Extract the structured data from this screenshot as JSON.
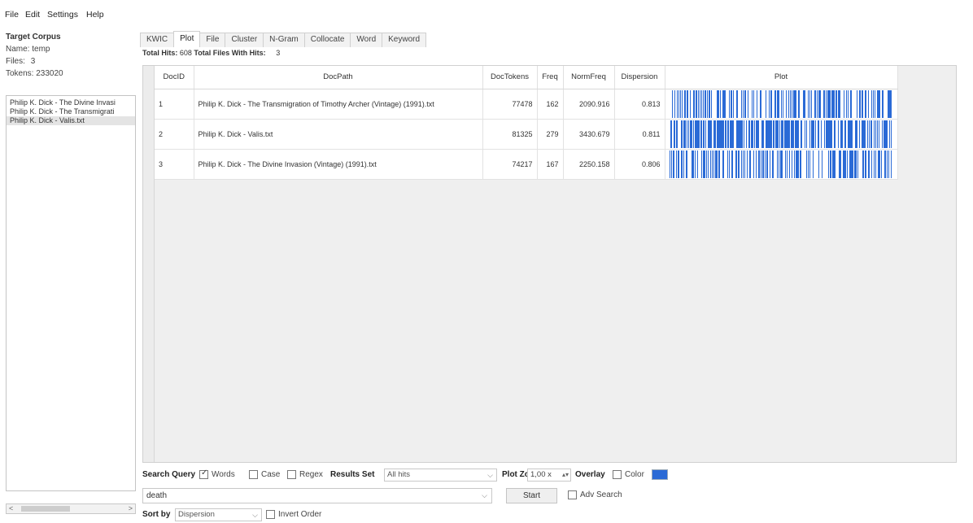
{
  "menu": [
    "File",
    "Edit",
    "Settings",
    "Help"
  ],
  "corpus": {
    "title": "Target Corpus",
    "name_label": "Name:",
    "name_value": "temp",
    "files_label": "Files:",
    "files_value": "3",
    "tokens_label": "Tokens:",
    "tokens_value": "233020",
    "files": [
      "Philip K. Dick - The Divine Invasi",
      "Philip K. Dick - The Transmigrati",
      "Philip K. Dick - Valis.txt"
    ],
    "selected_index": 2
  },
  "tabs": [
    "KWIC",
    "Plot",
    "File",
    "Cluster",
    "N-Gram",
    "Collocate",
    "Word",
    "Keyword"
  ],
  "active_tab": "Plot",
  "hits": {
    "total_hits_label": "Total Hits:",
    "total_hits_value": "608",
    "total_files_label": "Total Files With Hits:",
    "total_files_value": "3"
  },
  "table": {
    "columns": [
      "DocID",
      "DocPath",
      "DocTokens",
      "Freq",
      "NormFreq",
      "Dispersion",
      "Plot"
    ],
    "rows": [
      {
        "docid": "1",
        "docpath": "Philip K. Dick - The Transmigration of Timothy Archer (Vintage) (1991).txt",
        "doctokens": "77478",
        "freq": "162",
        "normfreq": "2090.916",
        "dispersion": "0.813"
      },
      {
        "docid": "2",
        "docpath": "Philip K. Dick - Valis.txt",
        "doctokens": "81325",
        "freq": "279",
        "normfreq": "3430.679",
        "dispersion": "0.811"
      },
      {
        "docid": "3",
        "docpath": "Philip K. Dick - The Divine Invasion (Vintage) (1991).txt",
        "doctokens": "74217",
        "freq": "167",
        "normfreq": "2250.158",
        "dispersion": "0.806"
      }
    ]
  },
  "controls": {
    "search_query_label": "Search Query",
    "words_label": "Words",
    "words_checked": true,
    "case_label": "Case",
    "case_checked": false,
    "regex_label": "Regex",
    "regex_checked": false,
    "results_set_label": "Results Set",
    "results_set_value": "All hits",
    "plot_zoom_label": "Plot Zoom",
    "plot_zoom_value": "1,00 x",
    "overlay_label": "Overlay",
    "overlay_checked": false,
    "color_label": "Color",
    "color_value": "#2a6ad6",
    "query_value": "death",
    "start_label": "Start",
    "adv_search_label": "Adv Search",
    "adv_search_checked": false,
    "sort_by_label": "Sort by",
    "sort_by_value": "Dispersion",
    "invert_order_label": "Invert Order",
    "invert_order_checked": false
  },
  "plot_color": "#2a6ad6"
}
